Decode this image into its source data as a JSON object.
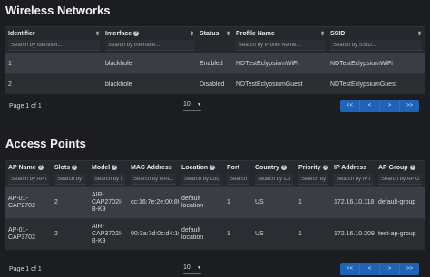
{
  "wireless": {
    "title": "Wireless Networks",
    "columns": [
      "Identifier",
      "Interface",
      "Status",
      "Profile Name",
      "SSID"
    ],
    "placeholders": [
      "Search by Identifier...",
      "Search by Interface...",
      "",
      "Search by Profile Name...",
      "Search by SSID..."
    ],
    "rows": [
      [
        "1",
        "blackhole",
        "Enabled",
        "NDTestEclypsiumWiFi",
        "NDTestEclypsiumWiFi"
      ],
      [
        "2",
        "blackhole",
        "Disabled",
        "NDTestEclypsiumGuest",
        "NDTestEclypsiumGuest"
      ]
    ],
    "page_label": "Page 1 of 1",
    "page_size": "10"
  },
  "access_points": {
    "title": "Access Points",
    "columns": [
      "AP Name",
      "Slots",
      "Model",
      "MAC Address",
      "Location",
      "Port",
      "Country",
      "Priority",
      "IP Address",
      "AP Group"
    ],
    "placeholders": [
      "Search by AP N",
      "Search by S",
      "Search by M",
      "Search by MAC A",
      "Search by Loca",
      "Search b",
      "Search by Cou",
      "Search by F",
      "Search by IP A",
      "Search by AP G"
    ],
    "rows": [
      [
        "AP-01-CAP2702",
        "2",
        "AIR-CAP2702I-B-K9",
        "cc:16:7e:2e:00:80",
        "default location",
        "1",
        "US",
        "1",
        "172.16.10.118",
        "default-group"
      ],
      [
        "AP-01-CAP3702",
        "2",
        "AIR-CAP3702I-B-K9",
        "00:3a:7d:0c:d4:10",
        "default location",
        "1",
        "US",
        "1",
        "172.16.10.209",
        "test-ap-group"
      ]
    ],
    "page_label": "Page 1 of 1",
    "page_size": "10"
  },
  "pager": [
    "<<",
    "<",
    ">",
    ">>"
  ]
}
